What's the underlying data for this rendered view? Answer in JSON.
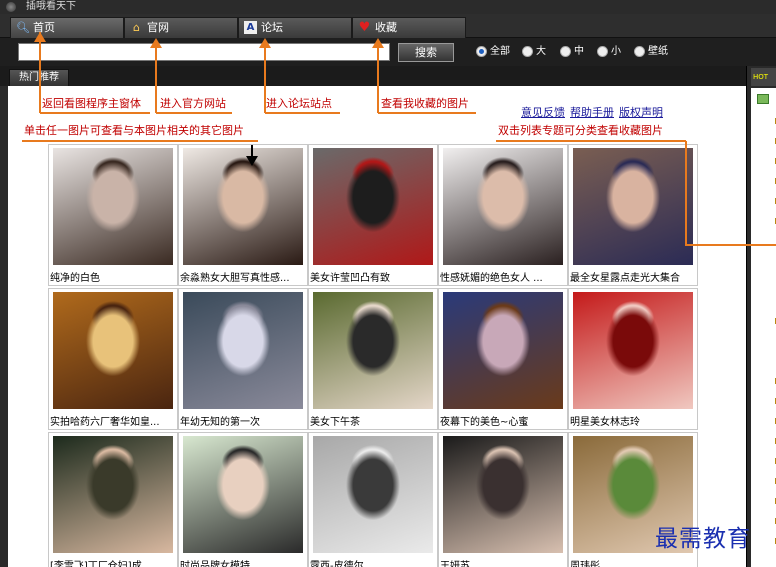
{
  "window": {
    "title": "插哦看天下"
  },
  "tabs": [
    {
      "label": "首页",
      "icon": "magnifier-icon"
    },
    {
      "label": "官网",
      "icon": "home-icon"
    },
    {
      "label": "论坛",
      "icon": "forum-icon"
    },
    {
      "label": "收藏",
      "icon": "heart-icon"
    }
  ],
  "search": {
    "value": "",
    "button_label": "搜索",
    "filters": [
      {
        "label": "全部",
        "selected": true
      },
      {
        "label": "大",
        "selected": false
      },
      {
        "label": "中",
        "selected": false
      },
      {
        "label": "小",
        "selected": false
      },
      {
        "label": "壁纸",
        "selected": false
      }
    ]
  },
  "subtab": {
    "label": "热门推荐"
  },
  "right_panel": {
    "header": "HOT"
  },
  "annotations": {
    "home": "返回看图程序主窗体",
    "website": "进入官方网站",
    "forum": "进入论坛站点",
    "favorites": "查看我收藏的图片",
    "click_hint": "单击任一图片可查看与本图片相关的其它图片",
    "dblclick_hint": "双击列表专题可分类查看收藏图片"
  },
  "links": {
    "feedback": "意见反馈",
    "help": "帮助手册",
    "copyright": "版权声明"
  },
  "gallery": [
    {
      "caption": "纯净的白色",
      "colors": [
        "#e9e4e2",
        "#c9b3a8",
        "#3a2a22"
      ]
    },
    {
      "caption": "余淼熟女大胆写真性感...",
      "colors": [
        "#efe9e4",
        "#d9b9a4",
        "#2a1a14"
      ]
    },
    {
      "caption": "美女许莹凹凸有致",
      "colors": [
        "#6a6a6a",
        "#1d1d1d",
        "#b01818"
      ]
    },
    {
      "caption": "性感妩媚的绝色女人 ...",
      "colors": [
        "#f1efef",
        "#dcbcaa",
        "#2a2020"
      ]
    },
    {
      "caption": "最全女星露点走光大集合",
      "colors": [
        "#7a5e52",
        "#d9b3a0",
        "#2b2b55"
      ]
    },
    {
      "caption": "实拍哈药六厂奢华如皇...",
      "colors": [
        "#b06a1c",
        "#e8c27a",
        "#4a2510"
      ]
    },
    {
      "caption": "年幼无知的第一次",
      "colors": [
        "#3a4a5a",
        "#d8d8e8",
        "#8a8a9a"
      ]
    },
    {
      "caption": "美女下午茶",
      "colors": [
        "#5a6a30",
        "#2a2a2a",
        "#e4d6c8"
      ]
    },
    {
      "caption": "夜幕下的美色~心蜜",
      "colors": [
        "#2a3a7a",
        "#c8a8b8",
        "#6a3a1a"
      ]
    },
    {
      "caption": "明星美女林志玲",
      "colors": [
        "#c41a1a",
        "#7a0a0a",
        "#f0c8c0"
      ]
    },
    {
      "caption": "[李雪飞]丁厂仓妇]成...",
      "colors": [
        "#1c2a1c",
        "#3a3a2a",
        "#d8b8a0"
      ]
    },
    {
      "caption": "时尚品牌女模特",
      "colors": [
        "#d8e8d0",
        "#e8d0c0",
        "#2a2a2a"
      ]
    },
    {
      "caption": "露西-皮德尔",
      "colors": [
        "#a8a8a8",
        "#3a3a3a",
        "#eaeaea"
      ]
    },
    {
      "caption": "王妍苏",
      "colors": [
        "#1a1a1a",
        "#3a3030",
        "#d8c0b0"
      ]
    },
    {
      "caption": "周玮彤",
      "colors": [
        "#8a6a3a",
        "#5a8a3a",
        "#e0c8b0"
      ]
    }
  ],
  "watermark": "最需教育",
  "colors": {
    "annotation": "#c00000",
    "arrow": "#e87a1e",
    "link": "#1a1a9a"
  }
}
